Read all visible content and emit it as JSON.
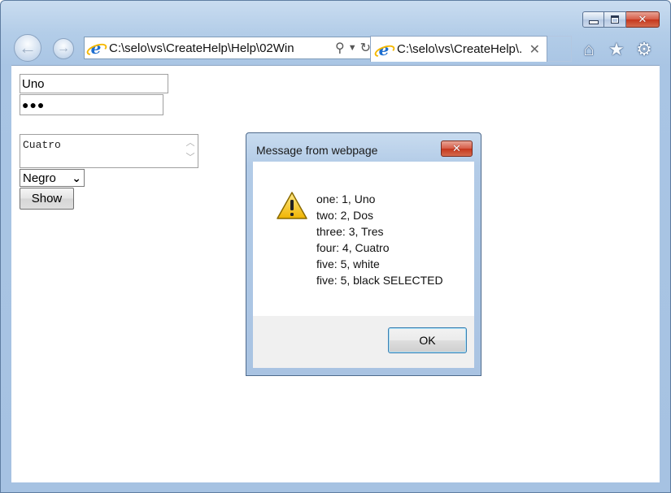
{
  "browser": {
    "address": "C:\\selo\\vs\\CreateHelp\\Help\\02Win",
    "tab_title": "C:\\selo\\vs\\CreateHelp\\...",
    "icons": [
      "minimize-icon",
      "maximize-icon",
      "close-icon",
      "back-icon",
      "forward-icon",
      "search-icon",
      "dropdown-icon",
      "refresh-icon",
      "home-icon",
      "favorites-icon",
      "settings-icon"
    ]
  },
  "form": {
    "input_one": "Uno",
    "input_two_masked": "●●●",
    "textarea": "Cuatro",
    "select_value": "Negro",
    "show_button": "Show"
  },
  "dialog": {
    "title": "Message from webpage",
    "lines": [
      "one: 1, Uno",
      "two: 2, Dos",
      "three: 3, Tres",
      "four: 4, Cuatro",
      "five: 5, white",
      "five: 5, black SELECTED"
    ],
    "ok_label": "OK"
  }
}
